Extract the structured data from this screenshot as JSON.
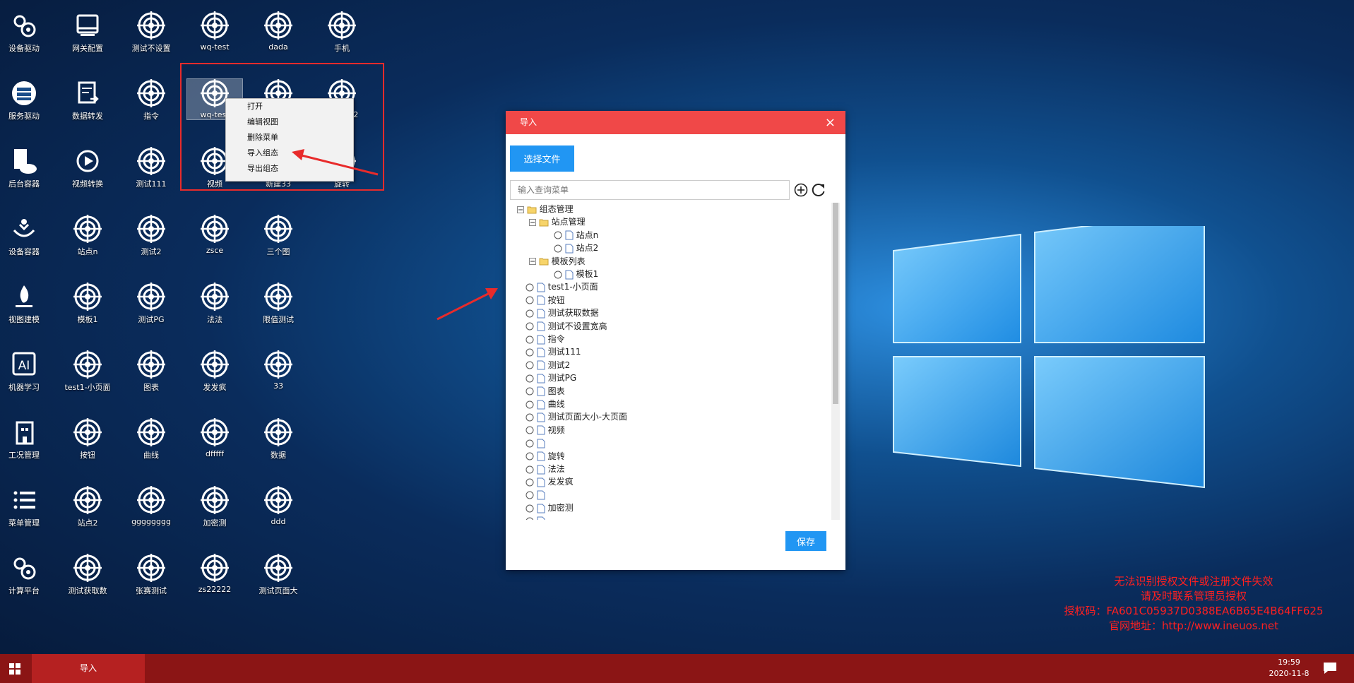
{
  "desktop": {
    "icons": [
      {
        "label": "设备驱动",
        "icon": "gears-icon"
      },
      {
        "label": "网关配置",
        "icon": "gateway-icon"
      },
      {
        "label": "测试不设置",
        "icon": "target-icon"
      },
      {
        "label": "wq-test",
        "icon": "target-icon"
      },
      {
        "label": "dada",
        "icon": "target-icon"
      },
      {
        "label": "手机",
        "icon": "target-icon"
      },
      {
        "label": "服务驱动",
        "icon": "server-icon"
      },
      {
        "label": "数据转发",
        "icon": "forward-icon"
      },
      {
        "label": "指令",
        "icon": "target-icon"
      },
      {
        "label": "wq-test",
        "icon": "target-icon"
      },
      {
        "label": "",
        "icon": "target-icon"
      },
      {
        "label": "zs22222",
        "icon": "target-icon"
      },
      {
        "label": "后台容器",
        "icon": "cloud-doc-icon"
      },
      {
        "label": "视频转换",
        "icon": "video-convert-icon"
      },
      {
        "label": "测试111",
        "icon": "target-icon"
      },
      {
        "label": "视频",
        "icon": "target-icon"
      },
      {
        "label": "新建33",
        "icon": "target-icon"
      },
      {
        "label": "旋转",
        "icon": "target-icon"
      },
      {
        "label": "设备容器",
        "icon": "hands-icon"
      },
      {
        "label": "站点n",
        "icon": "target-icon"
      },
      {
        "label": "测试2",
        "icon": "target-icon"
      },
      {
        "label": "zsce",
        "icon": "target-icon"
      },
      {
        "label": "三个图",
        "icon": "target-icon"
      },
      {
        "label": "视图建模",
        "icon": "flame-icon"
      },
      {
        "label": "模板1",
        "icon": "target-icon"
      },
      {
        "label": "测试PG",
        "icon": "target-icon"
      },
      {
        "label": "法法",
        "icon": "target-icon"
      },
      {
        "label": "限值测试",
        "icon": "target-icon"
      },
      {
        "label": "机器学习",
        "icon": "ai-icon"
      },
      {
        "label": "test1-小页面",
        "icon": "target-icon"
      },
      {
        "label": "图表",
        "icon": "target-icon"
      },
      {
        "label": "发发疯",
        "icon": "target-icon"
      },
      {
        "label": "33",
        "icon": "target-icon"
      },
      {
        "label": "工况管理",
        "icon": "building-icon"
      },
      {
        "label": "按钮",
        "icon": "target-icon"
      },
      {
        "label": "曲线",
        "icon": "target-icon"
      },
      {
        "label": "dfffff",
        "icon": "target-icon"
      },
      {
        "label": "数据",
        "icon": "target-icon"
      },
      {
        "label": "菜单管理",
        "icon": "list-icon"
      },
      {
        "label": "站点2",
        "icon": "target-icon"
      },
      {
        "label": "gggggggg",
        "icon": "target-icon"
      },
      {
        "label": "加密测",
        "icon": "target-icon"
      },
      {
        "label": "ddd",
        "icon": "target-icon"
      },
      {
        "label": "计算平台",
        "icon": "gears-icon"
      },
      {
        "label": "测试获取数",
        "icon": "target-icon"
      },
      {
        "label": "张赛测试",
        "icon": "target-icon"
      },
      {
        "label": "zs22222",
        "icon": "target-icon"
      },
      {
        "label": "测试页面大",
        "icon": "target-icon"
      }
    ]
  },
  "context_menu": {
    "items": [
      "打开",
      "编辑视图",
      "删除菜单",
      "导入组态",
      "导出组态"
    ]
  },
  "dialog": {
    "title": "导入",
    "close": "×",
    "select_file": "选择文件",
    "search_placeholder": "输入查询菜单",
    "save": "保存",
    "tree": {
      "root": "组态管理",
      "folders": [
        {
          "label": "站点管理",
          "children": [
            "站点n",
            "站点2"
          ]
        },
        {
          "label": "模板列表",
          "children": [
            "模板1"
          ]
        }
      ],
      "items": [
        "test1-小页面",
        "按钮",
        "测试获取数据",
        "测试不设置宽高",
        "指令",
        "测试111",
        "测试2",
        "测试PG",
        "图表",
        "曲线",
        "测试页面大小-大页面",
        "视频",
        "",
        "旋转",
        "法法",
        "发发疯",
        "",
        "加密测",
        ""
      ]
    }
  },
  "license": {
    "line1": "无法识别授权文件或注册文件失效",
    "line2": "请及时联系管理员授权",
    "line3": "授权码：FA601C05937D0388EA6B65E4B64FF625",
    "line4": "官网地址：http://www.ineuos.net"
  },
  "taskbar": {
    "task": "导入",
    "time": "19:59",
    "date": "2020-11-8"
  },
  "colors": {
    "accent": "#f04848",
    "button": "#2196f3",
    "taskbar": "#8b1515",
    "warning": "#ff2020"
  }
}
